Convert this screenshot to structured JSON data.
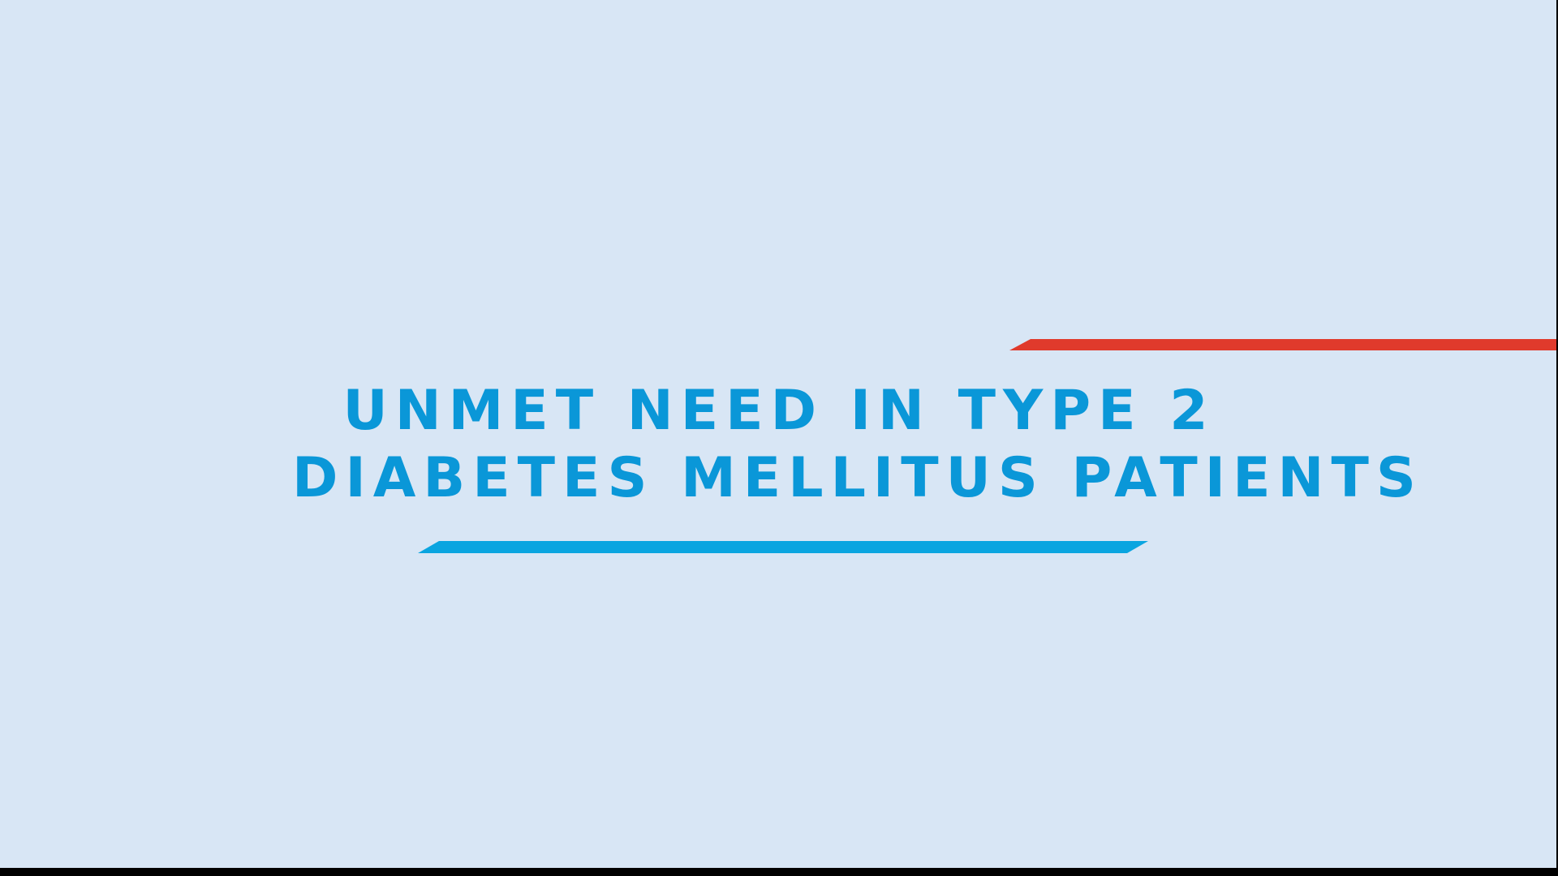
{
  "slide": {
    "title_line_1": "UNMET NEED IN TYPE 2",
    "title_line_2": "DIABETES MELLITUS PATIENTS"
  },
  "colors": {
    "background": "#d8e6f5",
    "title_text": "#0a97d8",
    "red_accent": "#e03a2c",
    "blue_accent": "#0aa5e0"
  }
}
